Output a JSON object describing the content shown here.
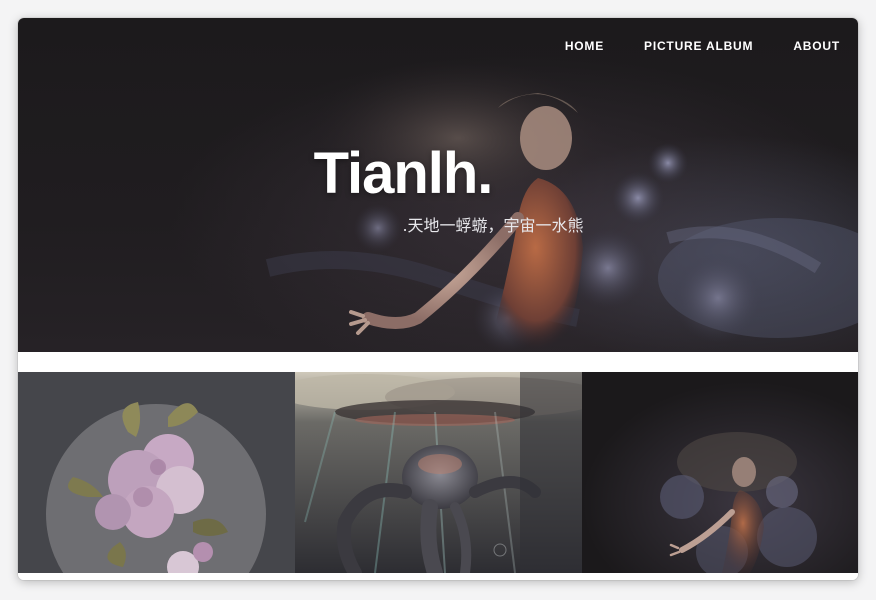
{
  "nav": {
    "items": [
      {
        "label": "HOME"
      },
      {
        "label": "PICTURE ALBUM"
      },
      {
        "label": "ABOUT"
      }
    ]
  },
  "hero": {
    "title": "Tianlh.",
    "tagline": ".天地一蜉蝣，宇宙一水熊"
  },
  "gallery": {
    "tiles": [
      {
        "subject": "flower-bouquet-painting",
        "bg": "#45464b"
      },
      {
        "subject": "underwater-jellyfish-painting",
        "bg": "#5a5955"
      },
      {
        "subject": "floating-girl-painting",
        "bg": "#1d1b1d"
      }
    ]
  },
  "colors": {
    "nav_text": "#ffffff",
    "hero_bg": "#1c1a1c",
    "page_bg": "#ffffff"
  }
}
